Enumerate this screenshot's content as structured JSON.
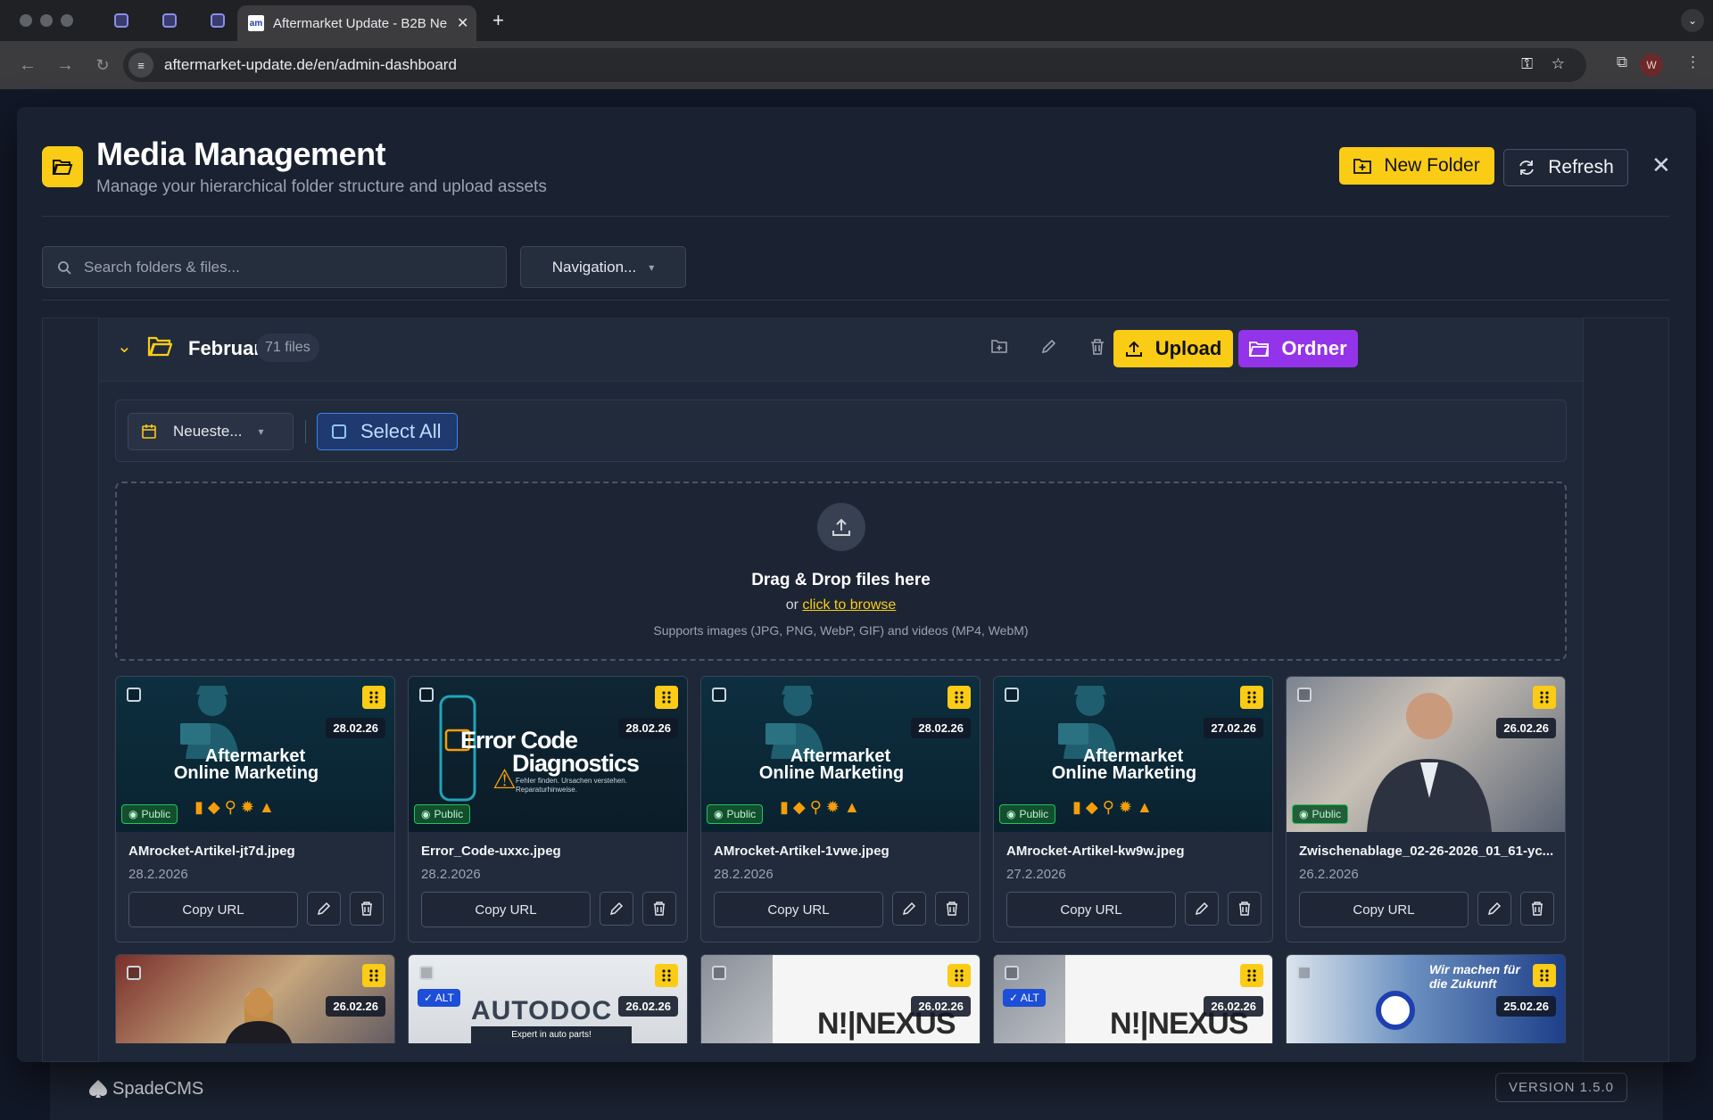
{
  "browser": {
    "active_tab_title": "Aftermarket Update - B2B Ne",
    "favicon_text": "am",
    "url": "aftermarket-update.de/en/admin-dashboard",
    "profile_initial": "W"
  },
  "modal": {
    "title": "Media Management",
    "subtitle": "Manage your hierarchical folder structure and upload assets",
    "new_folder_label": "New Folder",
    "refresh_label": "Refresh",
    "search_placeholder": "Search folders & files...",
    "navigation_label": "Navigation..."
  },
  "folder": {
    "name": "Februar",
    "count": "71 files",
    "upload_label": "Upload",
    "ordner_label": "Ordner",
    "sort_label": "Neueste...",
    "select_all_label": "Select All"
  },
  "dropzone": {
    "title": "Drag & Drop files here",
    "or_text": "or",
    "browse_link": "click to browse",
    "supports": "Supports images (JPG, PNG, WebP, GIF) and videos (MP4, WebM)"
  },
  "media_row1": [
    {
      "thumb": "am",
      "date_badge": "28.02.26",
      "badge": "Public",
      "filename": "AMrocket-Artikel-jt7d.jpeg",
      "date": "28.2.2026",
      "copy": "Copy URL"
    },
    {
      "thumb": "err",
      "date_badge": "28.02.26",
      "badge": "Public",
      "filename": "Error_Code-uxxc.jpeg",
      "date": "28.2.2026",
      "copy": "Copy URL"
    },
    {
      "thumb": "am",
      "date_badge": "28.02.26",
      "badge": "Public",
      "filename": "AMrocket-Artikel-1vwe.jpeg",
      "date": "28.2.2026",
      "copy": "Copy URL"
    },
    {
      "thumb": "am",
      "date_badge": "27.02.26",
      "badge": "Public",
      "filename": "AMrocket-Artikel-kw9w.jpeg",
      "date": "27.2.2026",
      "copy": "Copy URL"
    },
    {
      "thumb": "photo",
      "date_badge": "26.02.26",
      "badge": "Public",
      "filename": "Zwischenablage_02-26-2026_01_61-yc...",
      "date": "26.2.2026",
      "copy": "Copy URL"
    }
  ],
  "media_row2": [
    {
      "date_badge": "26.02.26",
      "badge": ""
    },
    {
      "date_badge": "26.02.26",
      "badge": "ALT"
    },
    {
      "date_badge": "26.02.26",
      "badge": ""
    },
    {
      "date_badge": "26.02.26",
      "badge": "ALT"
    },
    {
      "date_badge": "25.02.26",
      "badge": ""
    }
  ],
  "thumb_text": {
    "am_line1": "Aftermarket",
    "am_line2": "Online Marketing",
    "err_line1": "Error Code",
    "err_line2": "Diagnostics",
    "err_small1": "Fehler finden. Ursachen verstehen.",
    "err_small2": "Reparaturhinweise.",
    "autodoc": "AUTODOC",
    "autodoc_sub": "Expert in auto parts!",
    "nexus": "N!|NEXUS",
    "booth": "Wir machen für die Zukunft"
  },
  "footer": {
    "brand": "SpadeCMS",
    "version": "VERSION 1.5.0"
  },
  "colors": {
    "accent_yellow": "#facc15",
    "accent_purple": "#9333ea",
    "select_blue": "#3b82f6",
    "public_green": "#22c55e"
  }
}
